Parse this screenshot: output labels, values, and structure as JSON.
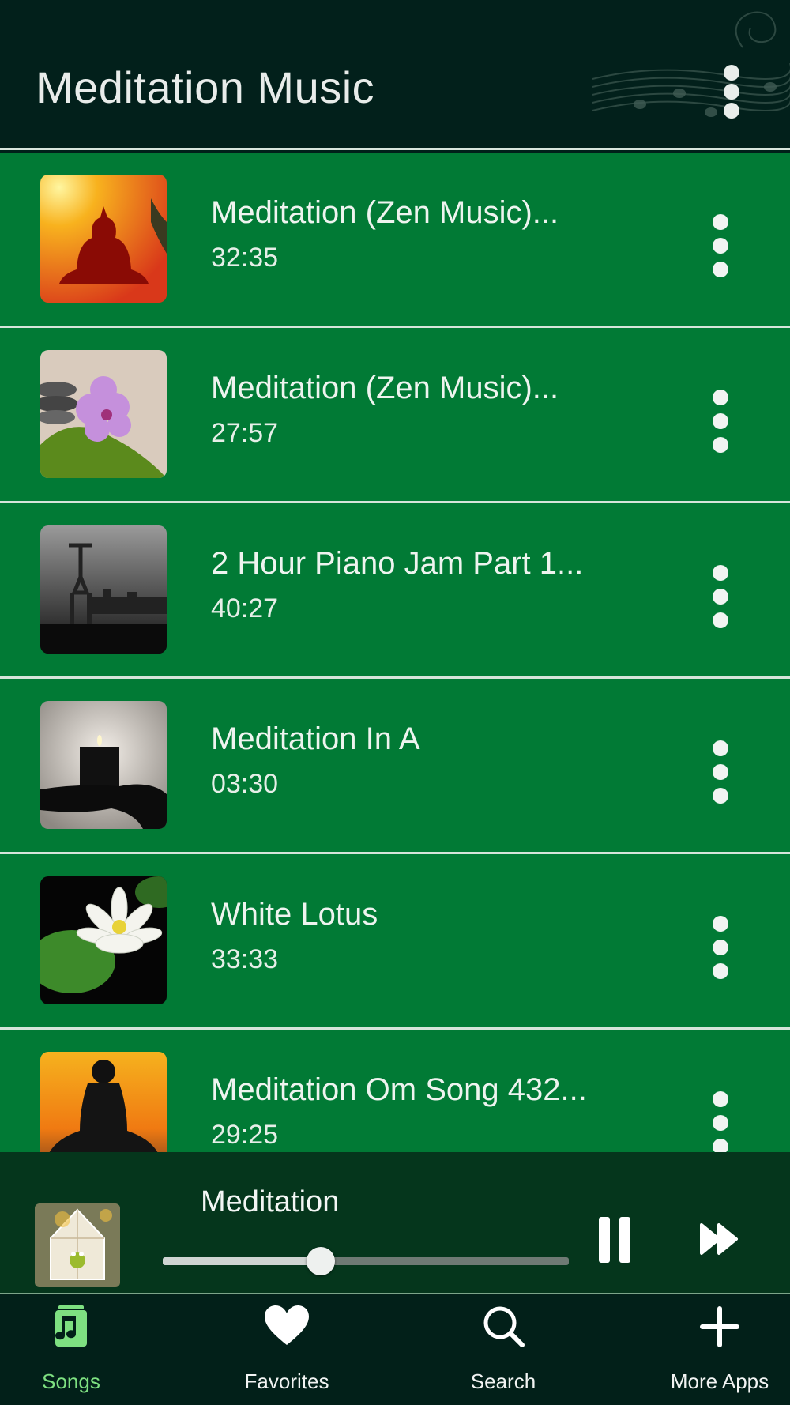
{
  "header": {
    "title": "Meditation Music"
  },
  "tracks": [
    {
      "title": "Meditation (Zen Music)...",
      "duration": "32:35",
      "art": "buddha-sunset-art"
    },
    {
      "title": "Meditation (Zen Music)...",
      "duration": "27:57",
      "art": "flower-stones-art"
    },
    {
      "title": "2 Hour Piano Jam Part 1...",
      "duration": "40:27",
      "art": "yoga-city-art"
    },
    {
      "title": "Meditation In A",
      "duration": "03:30",
      "art": "candle-hand-art"
    },
    {
      "title": "White Lotus",
      "duration": "33:33",
      "art": "white-lotus-art"
    },
    {
      "title": "Meditation Om Song 432...",
      "duration": "29:25",
      "art": "silhouette-sunset-art"
    }
  ],
  "now_playing": {
    "title": "Meditation",
    "progress": 0.39,
    "art": "frog-lantern-art"
  },
  "nav": {
    "active": "Songs",
    "items": [
      {
        "label": "Songs",
        "icon": "music-note-icon"
      },
      {
        "label": "Favorites",
        "icon": "heart-icon"
      },
      {
        "label": "Search",
        "icon": "search-icon"
      },
      {
        "label": "More Apps",
        "icon": "plus-icon"
      }
    ]
  },
  "colors": {
    "accent": "#7ee081",
    "row_bg": "#017a35",
    "header_bg": "#02201b",
    "player_bg": "#05361c"
  }
}
